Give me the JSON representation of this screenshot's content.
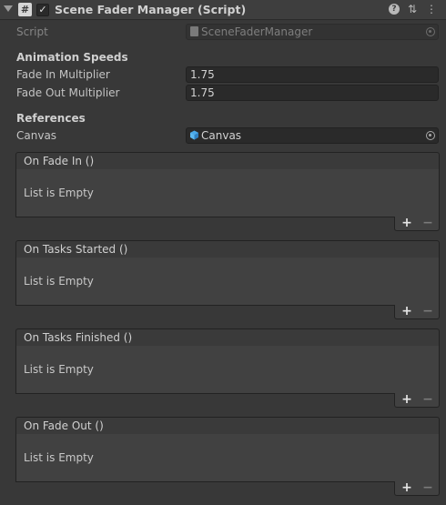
{
  "component": {
    "title": "Scene Fader Manager (Script)",
    "enabled_check": "✓",
    "script_glyph": "#",
    "help_glyph": "?",
    "preset_glyph": "⇅",
    "menu_glyph": "⋮"
  },
  "script_field": {
    "label": "Script",
    "value": "SceneFaderManager"
  },
  "animation_speeds": {
    "header": "Animation Speeds",
    "fade_in": {
      "label": "Fade In Multiplier",
      "value": "1.75"
    },
    "fade_out": {
      "label": "Fade Out Multiplier",
      "value": "1.75"
    }
  },
  "references": {
    "header": "References",
    "canvas": {
      "label": "Canvas",
      "value": "Canvas"
    }
  },
  "events": [
    {
      "title": "On Fade In ()",
      "empty_text": "List is Empty"
    },
    {
      "title": "On Tasks Started ()",
      "empty_text": "List is Empty"
    },
    {
      "title": "On Tasks Finished ()",
      "empty_text": "List is Empty"
    },
    {
      "title": "On Fade Out ()",
      "empty_text": "List is Empty"
    }
  ],
  "list_buttons": {
    "add": "+",
    "remove": "−"
  },
  "icons": {
    "foldout": "foldout-arrow-icon",
    "script": "script-hash-icon",
    "help": "help-icon",
    "presets": "presets-icon",
    "menu": "kebab-menu-icon",
    "object_picker": "object-picker-icon",
    "canvas_object": "canvas-cube-icon"
  },
  "colors": {
    "background": "#383838",
    "field": "#2a2a2a",
    "canvas_icon": "#4aa8e8"
  }
}
